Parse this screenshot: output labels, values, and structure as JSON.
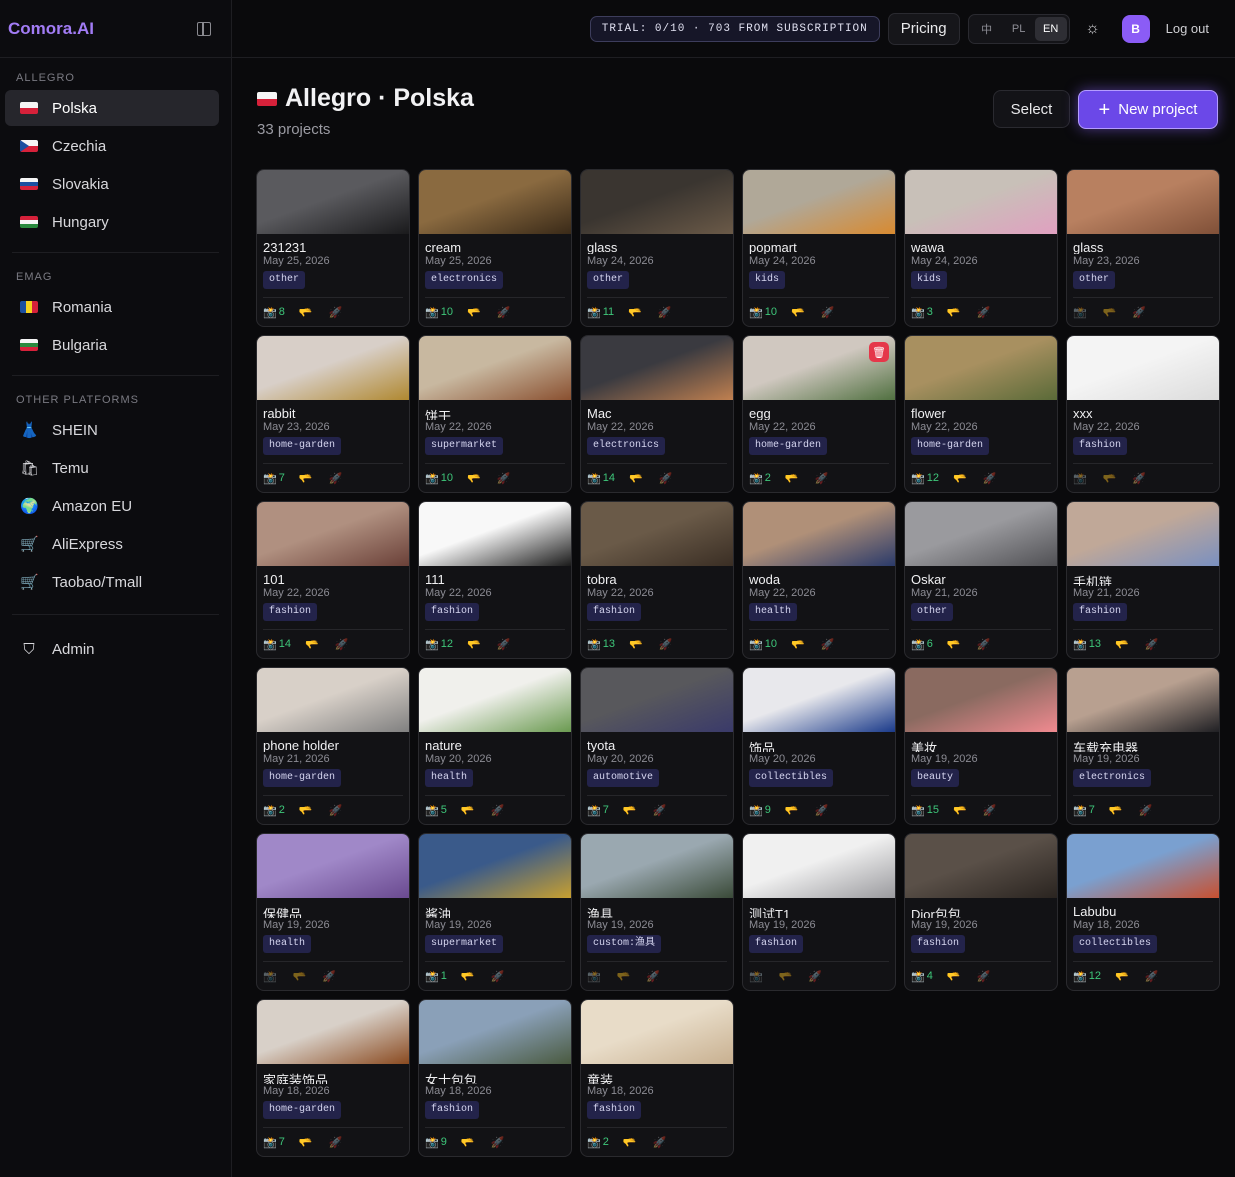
{
  "app": {
    "brand": "Comora.AI"
  },
  "sidebar": {
    "sections": [
      {
        "title": "ALLEGRO",
        "items": [
          {
            "label": "Polska",
            "icon": "flag-pl",
            "active": true
          },
          {
            "label": "Czechia",
            "icon": "flag-cz"
          },
          {
            "label": "Slovakia",
            "icon": "flag-sk"
          },
          {
            "label": "Hungary",
            "icon": "flag-hu"
          }
        ]
      },
      {
        "title": "EMAG",
        "items": [
          {
            "label": "Romania",
            "icon": "flag-ro"
          },
          {
            "label": "Bulgaria",
            "icon": "flag-bg"
          }
        ]
      },
      {
        "title": "OTHER PLATFORMS",
        "items": [
          {
            "label": "SHEIN",
            "icon": "dress-icon"
          },
          {
            "label": "Temu",
            "icon": "shopping-bags-icon"
          },
          {
            "label": "Amazon EU",
            "icon": "globe-icon"
          },
          {
            "label": "AliExpress",
            "icon": "cart-icon"
          },
          {
            "label": "Taobao/Tmall",
            "icon": "cart-icon"
          }
        ]
      }
    ],
    "admin": "Admin"
  },
  "topbar": {
    "trial": "TRIAL: 0/10 · 703 FROM SUBSCRIPTION",
    "pricing": "Pricing",
    "languages": [
      "中",
      "PL",
      "EN"
    ],
    "active_language": "EN",
    "avatar": "B",
    "logout": "Log out"
  },
  "page": {
    "title": "Allegro · Polska",
    "count": "33 projects",
    "select": "Select",
    "new_project": "New project"
  },
  "colors": {
    "accent": "#6b48e8",
    "tag_bg": "#23234a",
    "count_green": "#3ec77a",
    "delete_red": "#e5374a"
  },
  "projects": [
    {
      "name": "231231",
      "date": "May 25, 2026",
      "tag": "other",
      "count": "8",
      "thumb": [
        "#5a5a5e",
        "#1a1a1c"
      ]
    },
    {
      "name": "cream",
      "date": "May 25, 2026",
      "tag": "electronics",
      "count": "10",
      "thumb": [
        "#8a6a40",
        "#3a2a18"
      ]
    },
    {
      "name": "glass",
      "date": "May 24, 2026",
      "tag": "other",
      "count": "11",
      "thumb": [
        "#3a3530",
        "#6b5a48"
      ]
    },
    {
      "name": "popmart",
      "date": "May 24, 2026",
      "tag": "kids",
      "count": "10",
      "thumb": [
        "#b0a898",
        "#d88a30"
      ]
    },
    {
      "name": "wawa",
      "date": "May 24, 2026",
      "tag": "kids",
      "count": "3",
      "thumb": [
        "#c8c0b8",
        "#e0a0c0"
      ]
    },
    {
      "name": "glass",
      "date": "May 23, 2026",
      "tag": "other",
      "count": "",
      "thumb": [
        "#b88060",
        "#805038"
      ]
    },
    {
      "name": "rabbit",
      "date": "May 23, 2026",
      "tag": "home-garden",
      "count": "7",
      "thumb": [
        "#d8cfc8",
        "#b08830"
      ]
    },
    {
      "name": "饼干",
      "date": "May 22, 2026",
      "tag": "supermarket",
      "count": "10",
      "thumb": [
        "#c8b8a0",
        "#8a5030"
      ]
    },
    {
      "name": "Mac",
      "date": "May 22, 2026",
      "tag": "electronics",
      "count": "14",
      "thumb": [
        "#3a3a40",
        "#c08050"
      ]
    },
    {
      "name": "egg",
      "date": "May 22, 2026",
      "tag": "home-garden",
      "count": "2",
      "thumb": [
        "#d0c8c0",
        "#507040"
      ],
      "delete": true
    },
    {
      "name": "flower",
      "date": "May 22, 2026",
      "tag": "home-garden",
      "count": "12",
      "thumb": [
        "#a89060",
        "#5a6a38"
      ]
    },
    {
      "name": "xxx",
      "date": "May 22, 2026",
      "tag": "fashion",
      "count": "",
      "thumb": [
        "#f4f4f4",
        "#dcdcdc"
      ]
    },
    {
      "name": "101",
      "date": "May 22, 2026",
      "tag": "fashion",
      "count": "14",
      "thumb": [
        "#b09080",
        "#6a4038"
      ]
    },
    {
      "name": "111",
      "date": "May 22, 2026",
      "tag": "fashion",
      "count": "12",
      "thumb": [
        "#f8f8f8",
        "#1a1a1a"
      ]
    },
    {
      "name": "tobra",
      "date": "May 22, 2026",
      "tag": "fashion",
      "count": "13",
      "thumb": [
        "#6a5a48",
        "#3a2e24"
      ]
    },
    {
      "name": "woda",
      "date": "May 22, 2026",
      "tag": "health",
      "count": "10",
      "thumb": [
        "#b09078",
        "#2a3a6a"
      ]
    },
    {
      "name": "Oskar",
      "date": "May 21, 2026",
      "tag": "other",
      "count": "6",
      "thumb": [
        "#9a9a9e",
        "#505054"
      ]
    },
    {
      "name": "手机链",
      "date": "May 21, 2026",
      "tag": "fashion",
      "count": "13",
      "thumb": [
        "#c0a898",
        "#7a90c0"
      ]
    },
    {
      "name": "phone holder",
      "date": "May 21, 2026",
      "tag": "home-garden",
      "count": "2",
      "thumb": [
        "#d8d0c8",
        "#808080"
      ]
    },
    {
      "name": "nature",
      "date": "May 20, 2026",
      "tag": "health",
      "count": "5",
      "thumb": [
        "#f0f0ec",
        "#6a9a50"
      ]
    },
    {
      "name": "tyota",
      "date": "May 20, 2026",
      "tag": "automotive",
      "count": "7",
      "thumb": [
        "#58585c",
        "#3a3a6a"
      ]
    },
    {
      "name": "饰品",
      "date": "May 20, 2026",
      "tag": "collectibles",
      "count": "9",
      "thumb": [
        "#e8e8ec",
        "#1a3a8a"
      ]
    },
    {
      "name": "美妆",
      "date": "May 19, 2026",
      "tag": "beauty",
      "count": "15",
      "thumb": [
        "#8a6a60",
        "#f08a90"
      ]
    },
    {
      "name": "车载充电器",
      "date": "May 19, 2026",
      "tag": "electronics",
      "count": "7",
      "thumb": [
        "#b8a090",
        "#202024"
      ]
    },
    {
      "name": "保健品",
      "date": "May 19, 2026",
      "tag": "health",
      "count": "",
      "thumb": [
        "#a088c8",
        "#6a4a90"
      ]
    },
    {
      "name": "酱油",
      "date": "May 19, 2026",
      "tag": "supermarket",
      "count": "1",
      "thumb": [
        "#3a5a8a",
        "#c8a030"
      ]
    },
    {
      "name": "渔具",
      "date": "May 19, 2026",
      "tag": "custom:渔具",
      "count": "",
      "thumb": [
        "#9aa8b0",
        "#3a4a38"
      ]
    },
    {
      "name": "测试T1",
      "date": "May 19, 2026",
      "tag": "fashion",
      "count": "",
      "thumb": [
        "#f0f0f0",
        "#9a9a9e"
      ]
    },
    {
      "name": "Dior包包",
      "date": "May 19, 2026",
      "tag": "fashion",
      "count": "4",
      "thumb": [
        "#5a5048",
        "#2a2420"
      ]
    },
    {
      "name": "Labubu",
      "date": "May 18, 2026",
      "tag": "collectibles",
      "count": "12",
      "thumb": [
        "#7aa0d0",
        "#c85030"
      ]
    },
    {
      "name": "家庭装饰品",
      "date": "May 18, 2026",
      "tag": "home-garden",
      "count": "7",
      "thumb": [
        "#d8d0c8",
        "#8a4a20"
      ]
    },
    {
      "name": "女士包包",
      "date": "May 18, 2026",
      "tag": "fashion",
      "count": "9",
      "thumb": [
        "#8aa0b8",
        "#4a5a40"
      ]
    },
    {
      "name": "童装",
      "date": "May 18, 2026",
      "tag": "fashion",
      "count": "2",
      "thumb": [
        "#e8dcc8",
        "#c8b090"
      ]
    }
  ]
}
